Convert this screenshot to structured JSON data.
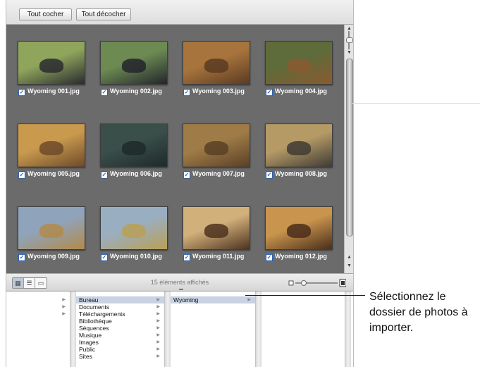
{
  "toolbar": {
    "check_all_label": "Tout cocher",
    "uncheck_all_label": "Tout décocher"
  },
  "thumbnails": [
    {
      "filename": "Wyoming 001.jpg",
      "checked": true,
      "subject": "raven",
      "colors": [
        "#8fa55c",
        "#2a2b30"
      ]
    },
    {
      "filename": "Wyoming 002.jpg",
      "checked": true,
      "subject": "raven-on-post",
      "colors": [
        "#6c8a52",
        "#23252c"
      ]
    },
    {
      "filename": "Wyoming 003.jpg",
      "checked": true,
      "subject": "elk",
      "colors": [
        "#a8743d",
        "#5a3b22"
      ]
    },
    {
      "filename": "Wyoming 004.jpg",
      "checked": true,
      "subject": "elk",
      "colors": [
        "#5e6b3a",
        "#8a5a30"
      ]
    },
    {
      "filename": "Wyoming 005.jpg",
      "checked": true,
      "subject": "elk-in-field",
      "colors": [
        "#c99a4e",
        "#6e4a2a"
      ]
    },
    {
      "filename": "Wyoming 006.jpg",
      "checked": true,
      "subject": "horses",
      "colors": [
        "#3a4e4a",
        "#1e2a2a"
      ]
    },
    {
      "filename": "Wyoming 007.jpg",
      "checked": true,
      "subject": "bison-herd",
      "colors": [
        "#9f7c47",
        "#5b4026"
      ]
    },
    {
      "filename": "Wyoming 008.jpg",
      "checked": true,
      "subject": "bison-fence",
      "colors": [
        "#b59a66",
        "#3f3b34"
      ]
    },
    {
      "filename": "Wyoming 009.jpg",
      "checked": true,
      "subject": "bison-mountains",
      "colors": [
        "#8fa4bb",
        "#b28a4c"
      ]
    },
    {
      "filename": "Wyoming 010.jpg",
      "checked": true,
      "subject": "horses-meadow",
      "colors": [
        "#9aaec2",
        "#b9a056"
      ]
    },
    {
      "filename": "Wyoming 011.jpg",
      "checked": true,
      "subject": "bison-closeup",
      "colors": [
        "#d2b07a",
        "#4d3320"
      ]
    },
    {
      "filename": "Wyoming 012.jpg",
      "checked": true,
      "subject": "bison-lying",
      "colors": [
        "#c9954e",
        "#4a2e1a"
      ]
    }
  ],
  "status": {
    "count_text": "15 éléments affichés",
    "zoom_level": 0.2
  },
  "browser": {
    "col1_arrows": 3,
    "col2_items": [
      {
        "label": "Bureau",
        "selected": true
      },
      {
        "label": "Documents",
        "selected": false
      },
      {
        "label": "Téléchargements",
        "selected": false
      },
      {
        "label": "Bibliothèque",
        "selected": false
      },
      {
        "label": "Séquences",
        "selected": false
      },
      {
        "label": "Musique",
        "selected": false
      },
      {
        "label": "Images",
        "selected": false
      },
      {
        "label": "Public",
        "selected": false
      },
      {
        "label": "Sites",
        "selected": false
      }
    ],
    "col3_items": [
      {
        "label": "Wyoming",
        "selected": true
      }
    ]
  },
  "callout": {
    "text": "Sélectionnez le dossier de photos à importer."
  }
}
